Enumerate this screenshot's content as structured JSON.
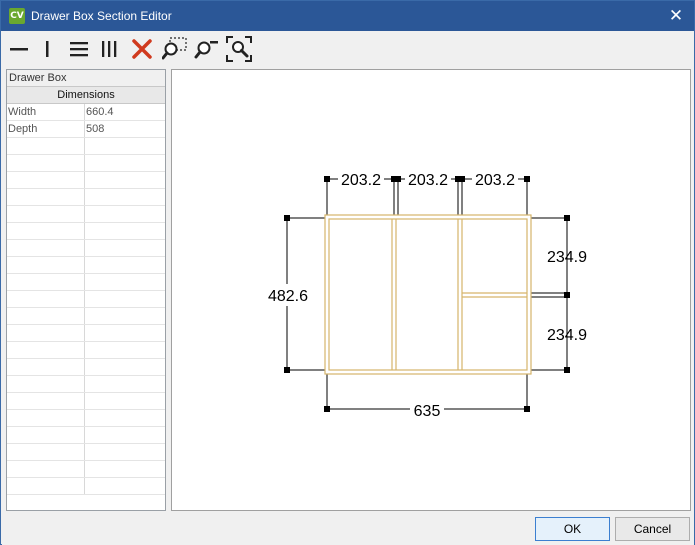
{
  "window": {
    "app_icon_text": "CV",
    "title": "Drawer Box Section Editor",
    "close_glyph": "✕"
  },
  "toolbar": {
    "tools": [
      {
        "name": "horizontal-divider-icon"
      },
      {
        "name": "vertical-divider-icon"
      },
      {
        "name": "horizontal-grid-icon"
      },
      {
        "name": "vertical-grid-icon"
      },
      {
        "name": "delete-icon",
        "color": "#d03a1e"
      },
      {
        "name": "zoom-window-icon"
      },
      {
        "name": "zoom-out-icon"
      },
      {
        "name": "zoom-extents-icon"
      }
    ]
  },
  "panel": {
    "title": "Drawer Box",
    "column_header": "Dimensions",
    "rows": [
      {
        "label": "Width",
        "value": "660.4"
      },
      {
        "label": "Depth",
        "value": "508"
      }
    ]
  },
  "drawing": {
    "top_dims": [
      "203.2",
      "203.2",
      "203.2"
    ],
    "right_dims": [
      "234.9",
      "234.9"
    ],
    "left_dim": "482.6",
    "bottom_dim": "635",
    "outline_color": "#d6b56a"
  },
  "footer": {
    "ok_label": "OK",
    "cancel_label": "Cancel"
  }
}
